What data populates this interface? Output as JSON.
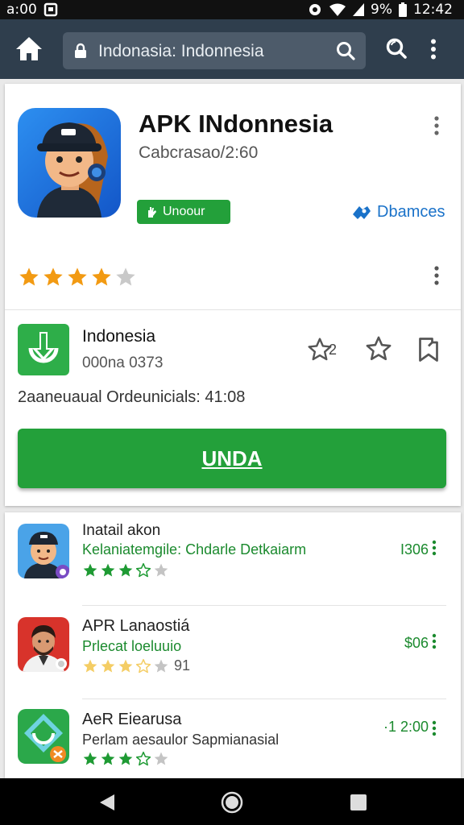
{
  "status_bar": {
    "time_left": "a:00",
    "battery": "9%",
    "time_right": "12:42"
  },
  "toolbar": {
    "url": "Indonasia: Indonnesia"
  },
  "app": {
    "title": "APK INdonnesia",
    "subtitle": "Cabcrasao/2:60",
    "chip_label": "Unoour",
    "developer_label": "Dbamces",
    "rating": 4,
    "rating_max": 5
  },
  "download": {
    "name": "Indonesia",
    "code": "000na 0373",
    "rating_count": "2",
    "info": "2aaneuaual Ordeunicials: 41:08",
    "install_label": "UNDA"
  },
  "list": [
    {
      "title": "Inatail akon",
      "subtitle": "Kelaniatemgile: Chdarle Detkaiarm",
      "price": "I306",
      "stars": 4,
      "stars_color": "#1e9a33",
      "count": ""
    },
    {
      "title": "APR Lanaostiá",
      "subtitle": "Prlecat loeluuio",
      "price": "$06",
      "stars": 4,
      "stars_color": "#f4cd64",
      "count": "91"
    },
    {
      "title": "AeR Eiearusa",
      "subtitle": "Perlam aesaulor Sapmianasial",
      "price": "·1 2:00",
      "stars": 4,
      "stars_color": "#1e9a33",
      "count": ""
    }
  ],
  "colors": {
    "accent": "#23a03a",
    "appbar": "#2f3e4d",
    "star": "#f29a12",
    "link": "#1a72c9"
  }
}
